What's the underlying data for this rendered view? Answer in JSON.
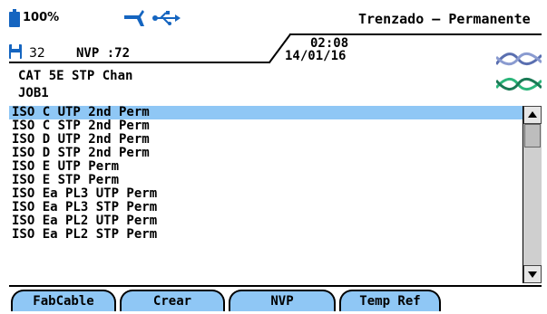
{
  "status": {
    "battery": "100%",
    "memory_count": "32",
    "nvp": "NVP :72",
    "time": "02:08",
    "date": "14/01/16"
  },
  "header": {
    "title": "Trenzado – Permanente",
    "cable_type": "CAT 5E STP Chan",
    "job": "JOB1"
  },
  "limits_list": {
    "items": [
      "ISO C UTP 2nd Perm",
      "ISO C STP 2nd Perm",
      "ISO D UTP 2nd Perm",
      "ISO D STP 2nd Perm",
      "ISO E UTP Perm",
      "ISO E STP Perm",
      "ISO Ea PL3 UTP Perm",
      "ISO Ea PL3 STP Perm",
      "ISO Ea PL2 UTP Perm",
      "ISO Ea PL2 STP Perm"
    ],
    "selected_index": 0,
    "scroll_fraction": 0.0
  },
  "softkeys": {
    "fabcable": "FabCable",
    "crear": "Crear",
    "nvp": "NVP",
    "temp_ref": "Temp Ref"
  },
  "colors": {
    "selection": "#8fc7f5",
    "softkey": "#8fc7f5",
    "icon_blue": "#1565c0",
    "twisted_pair_blue": "#5a6fb0",
    "twisted_pair_green": "#2bb57a"
  },
  "icons": {
    "battery": "battery-icon",
    "memory": "floppy-disk-icon",
    "tool": "probe-icon",
    "usb": "usb-icon",
    "cable": "twisted-pair-icon"
  }
}
